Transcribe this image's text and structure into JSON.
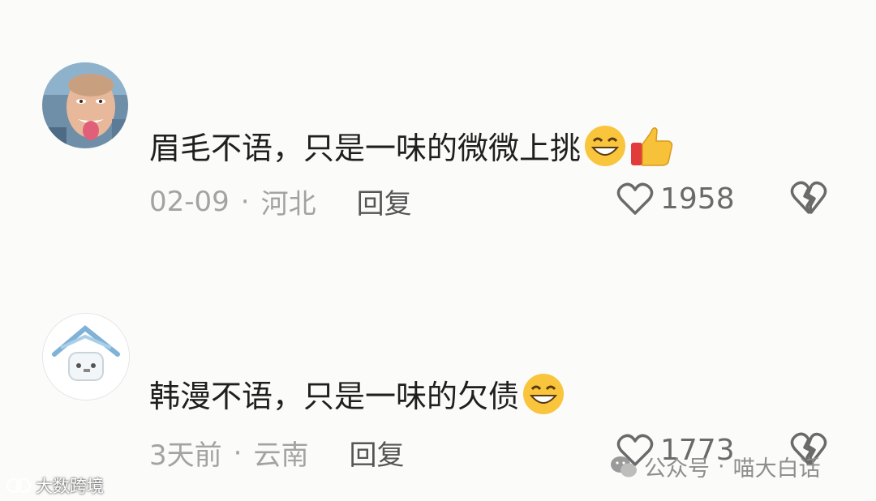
{
  "comments": [
    {
      "text": "眉毛不语，只是一味的微微上挑",
      "date": "02-09",
      "separator": "·",
      "location": "河北",
      "reply_label": "回复",
      "likes": "1958",
      "emojis": [
        "grin-emoji",
        "thumbs-up-emoji"
      ]
    },
    {
      "text": "韩漫不语，只是一味的欠债",
      "date": "3天前",
      "separator": "·",
      "location": "云南",
      "reply_label": "回复",
      "likes": "1773",
      "emojis": [
        "grin-emoji"
      ]
    }
  ],
  "watermarks": {
    "left": "大数跨境",
    "right_prefix": "公众号",
    "right_separator": "·",
    "right_name": "喵大白话"
  }
}
